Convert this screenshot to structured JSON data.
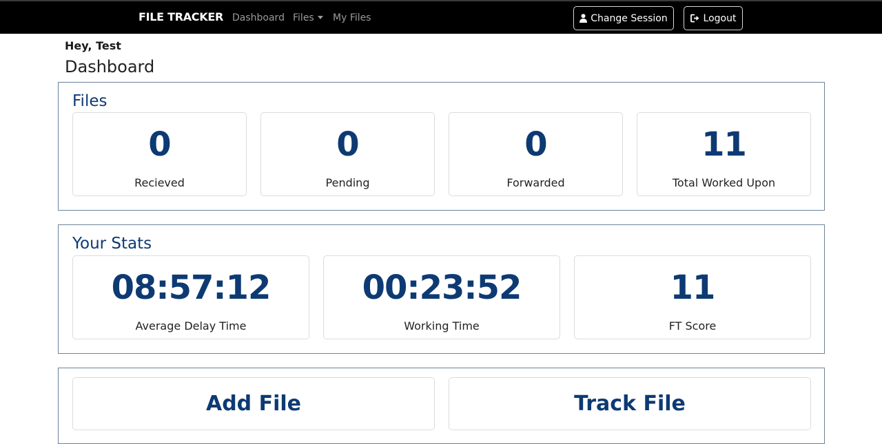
{
  "navbar": {
    "brand": "FILE TRACKER",
    "links": {
      "dashboard": "Dashboard",
      "files": "Files",
      "my_files": "My Files"
    },
    "buttons": {
      "change_session": "Change Session",
      "logout": "Logout"
    }
  },
  "header": {
    "greeting": "Hey, Test",
    "title": "Dashboard"
  },
  "files_section": {
    "title": "Files",
    "cards": [
      {
        "value": "0",
        "label": "Recieved"
      },
      {
        "value": "0",
        "label": "Pending"
      },
      {
        "value": "0",
        "label": "Forwarded"
      },
      {
        "value": "11",
        "label": "Total Worked Upon"
      }
    ]
  },
  "stats_section": {
    "title": "Your Stats",
    "cards": [
      {
        "value": "08:57:12",
        "label": "Average Delay Time"
      },
      {
        "value": "00:23:52",
        "label": "Working Time"
      },
      {
        "value": "11",
        "label": "FT Score"
      }
    ]
  },
  "actions": {
    "add_file": "Add File",
    "track_file": "Track File"
  },
  "icons": {
    "change_session": "user-icon",
    "logout": "logout-icon",
    "files_menu": "caret-down-icon"
  },
  "colors": {
    "navbar": "#000000",
    "accent": "#0d3a73",
    "section_border": "#6b8299"
  }
}
